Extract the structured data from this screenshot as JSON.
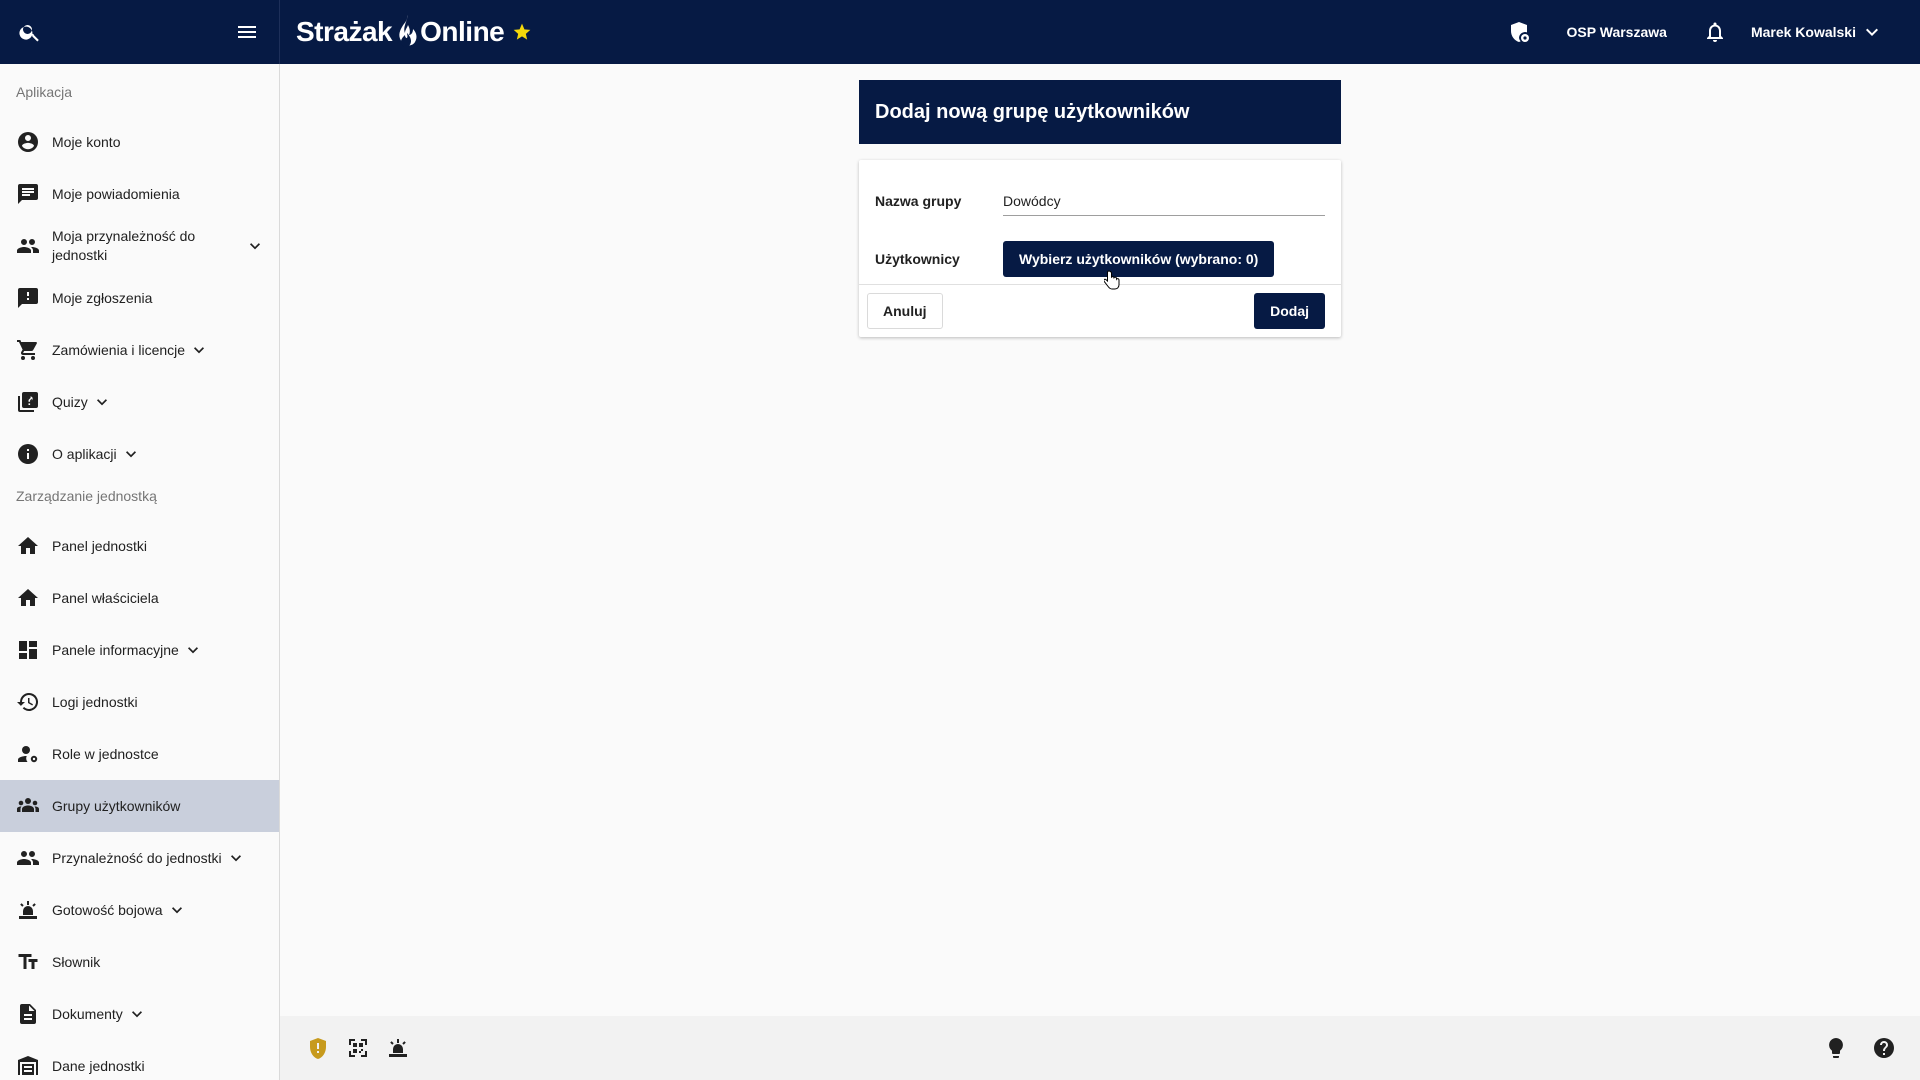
{
  "header": {
    "brand_left": "Strażak",
    "brand_right": "Online",
    "unit": "OSP Warszawa",
    "user": "Marek Kowalski"
  },
  "sidebar": {
    "section_app": "Aplikacja",
    "section_unit": "Zarządzanie jednostką",
    "app_items": [
      {
        "label": "Moje konto",
        "icon": "account-circle-icon"
      },
      {
        "label": "Moje powiadomienia",
        "icon": "message-icon"
      },
      {
        "label": "Moja przynależność do jednostki",
        "icon": "people-icon"
      },
      {
        "label": "Moje zgłoszenia",
        "icon": "feedback-icon"
      },
      {
        "label": "Zamówienia i licencje",
        "icon": "cart-icon"
      },
      {
        "label": "Quizy",
        "icon": "quiz-icon"
      },
      {
        "label": "O aplikacji",
        "icon": "info-icon"
      }
    ],
    "unit_items": [
      {
        "label": "Panel jednostki",
        "icon": "home-icon"
      },
      {
        "label": "Panel właściciela",
        "icon": "home-icon"
      },
      {
        "label": "Panele informacyjne",
        "icon": "dashboard-icon"
      },
      {
        "label": "Logi jednostki",
        "icon": "history-icon"
      },
      {
        "label": "Role w jednostce",
        "icon": "person-gear-icon"
      },
      {
        "label": "Grupy użytkowników",
        "icon": "groups-icon"
      },
      {
        "label": "Przynależność do jednostki",
        "icon": "people-icon"
      },
      {
        "label": "Gotowość bojowa",
        "icon": "siren-icon"
      },
      {
        "label": "Słownik",
        "icon": "text-fields-icon"
      },
      {
        "label": "Dokumenty",
        "icon": "document-icon"
      },
      {
        "label": "Dane jednostki",
        "icon": "fire-station-icon"
      }
    ]
  },
  "form": {
    "title": "Dodaj nową grupę użytkowników",
    "name_label": "Nazwa grupy",
    "name_value": "Dowódcy",
    "users_label": "Użytkownicy",
    "users_button": "Wybierz użytkowników (wybrano: 0)",
    "cancel": "Anuluj",
    "submit": "Dodaj"
  },
  "colors": {
    "primary": "#061a44",
    "active_nav": "#c9cfdc",
    "star": "#f5d90a",
    "shield": "#c79a1d"
  }
}
